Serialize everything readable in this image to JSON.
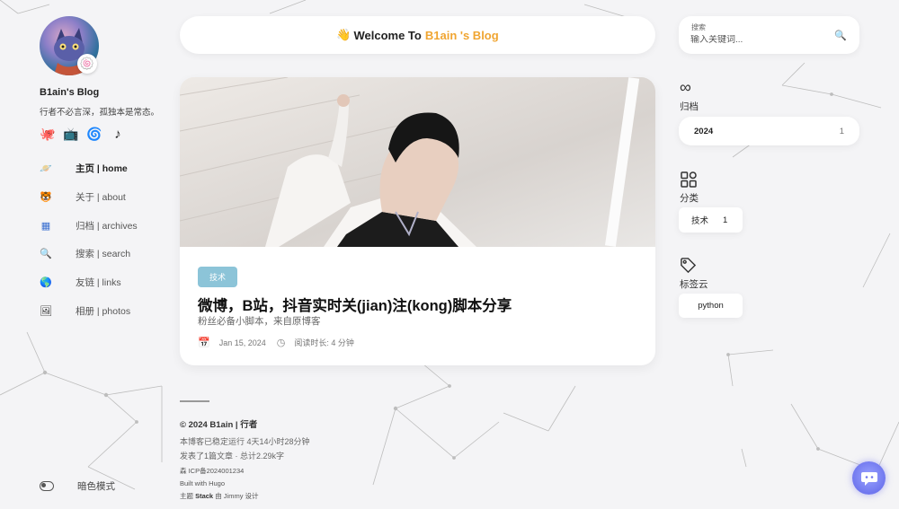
{
  "profile": {
    "avatar_badge_emoji": "🍥",
    "site_name": "B1ain's Blog",
    "description": "行者不必言深，孤独本是常态。"
  },
  "social": [
    {
      "name": "github-icon",
      "glyph": "🐙"
    },
    {
      "name": "bilibili-icon",
      "glyph": "📺"
    },
    {
      "name": "weibo-icon",
      "glyph": "🌀"
    },
    {
      "name": "tiktok-icon",
      "glyph": "♪"
    }
  ],
  "menu": [
    {
      "label": "主页 | home",
      "icon": "🪐",
      "active": true
    },
    {
      "label": "关于 | about",
      "icon": "🐯",
      "active": false
    },
    {
      "label": "归档 | archives",
      "icon": "▦",
      "active": false
    },
    {
      "label": "搜索 | search",
      "icon": "🔍",
      "active": false
    },
    {
      "label": "友链 | links",
      "icon": "🌎",
      "active": false
    },
    {
      "label": "相册 | photos",
      "icon": "🖼",
      "active": false
    }
  ],
  "dark_mode_label": "暗色模式",
  "header": {
    "hand": "👋",
    "welcome_prefix": "Welcome To",
    "welcome_accent": "B1ain 's Blog"
  },
  "post": {
    "category": "技术",
    "title": "微博，B站，抖音实时关(jian)注(kong)脚本分享",
    "subtitle": "粉丝必备小脚本，来自原博客",
    "date": "Jan 15, 2024",
    "reading_time": "阅读时长: 4 分钟"
  },
  "footer": {
    "copyright": "© 2024 B1ain | 行者",
    "uptime": "本博客已稳定运行 4天14小时28分钟",
    "stats": "发表了1篇文章 · 总计2.29k字",
    "icp": "森 ICP备2024001234",
    "built_with": "Built with Hugo",
    "theme_prefix": "主题",
    "theme_name": "Stack",
    "theme_suffix": "由 Jimmy 设计"
  },
  "search": {
    "label": "搜索",
    "placeholder": "输入关键词..."
  },
  "widgets": {
    "archives_title": "归档",
    "archive_year": "2024",
    "archive_count": "1",
    "categories_title": "分类",
    "category_name": "技术",
    "category_count": "1",
    "tagcloud_title": "标签云",
    "tag": "python"
  },
  "colors": {
    "accent": "#f0a531",
    "tag_pill": "#8cc4d8",
    "chat_button": "#6f76ee",
    "background": "#f4f4f6"
  }
}
